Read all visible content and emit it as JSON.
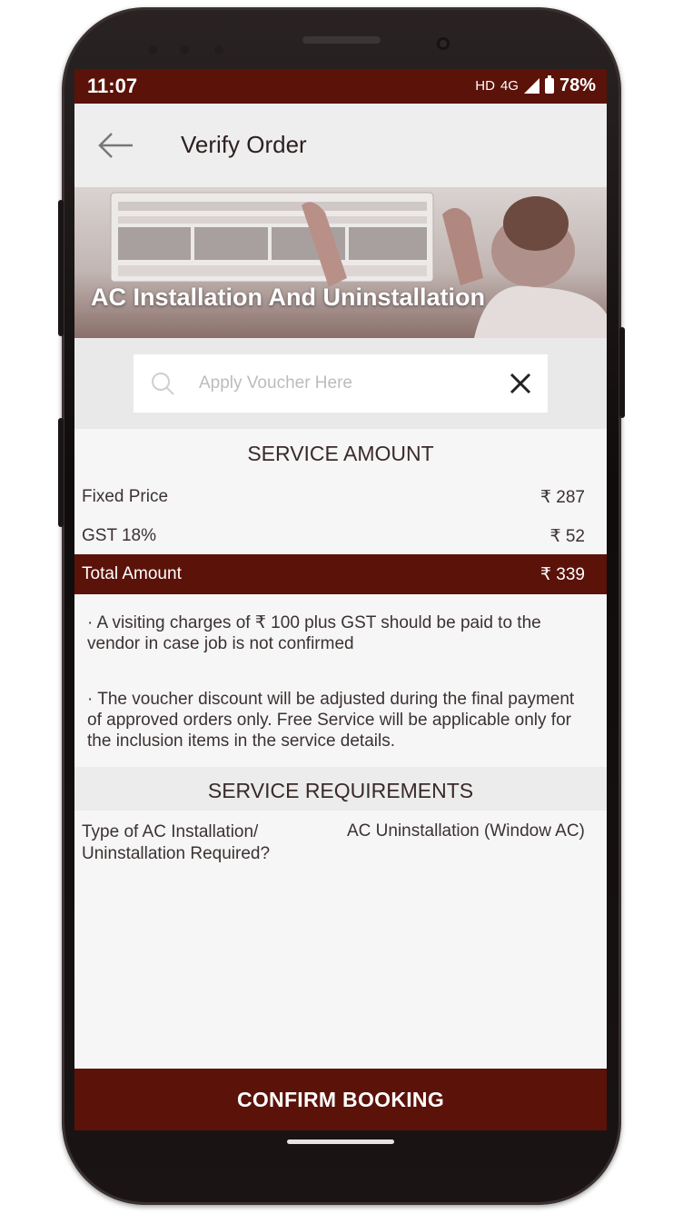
{
  "status_bar": {
    "time": "11:07",
    "network_hd": "HD",
    "network_4g": "4G",
    "battery": "78%"
  },
  "app_bar": {
    "title": "Verify Order",
    "back_icon": "arrow-left-icon"
  },
  "banner": {
    "title": "AC Installation And Uninstallation"
  },
  "voucher": {
    "placeholder": "Apply Voucher Here",
    "search_icon": "search-icon",
    "clear_icon": "close-icon"
  },
  "service_amount": {
    "heading": "SERVICE AMOUNT",
    "rows": [
      {
        "label": "Fixed Price",
        "amount": "₹ 287"
      },
      {
        "label": "GST 18%",
        "amount": "₹ 52"
      }
    ],
    "total": {
      "label": "Total Amount",
      "amount": "₹ 339"
    }
  },
  "notes": [
    "· A visiting charges of ₹ 100 plus GST should be paid to the vendor in case job is not confirmed",
    "· The voucher discount will be adjusted during the final payment of approved orders only. Free Service will be applicable only for the inclusion items in the service details."
  ],
  "service_requirements": {
    "heading": "SERVICE REQUIREMENTS",
    "question": "Type of AC Installation/ Uninstallation Required?",
    "answer": "AC Uninstallation (Window AC)"
  },
  "confirm_button": {
    "label": "CONFIRM BOOKING"
  },
  "colors": {
    "brand": "#5b1209",
    "background": "#f7f6f6",
    "app_bar": "#eeeeee"
  }
}
